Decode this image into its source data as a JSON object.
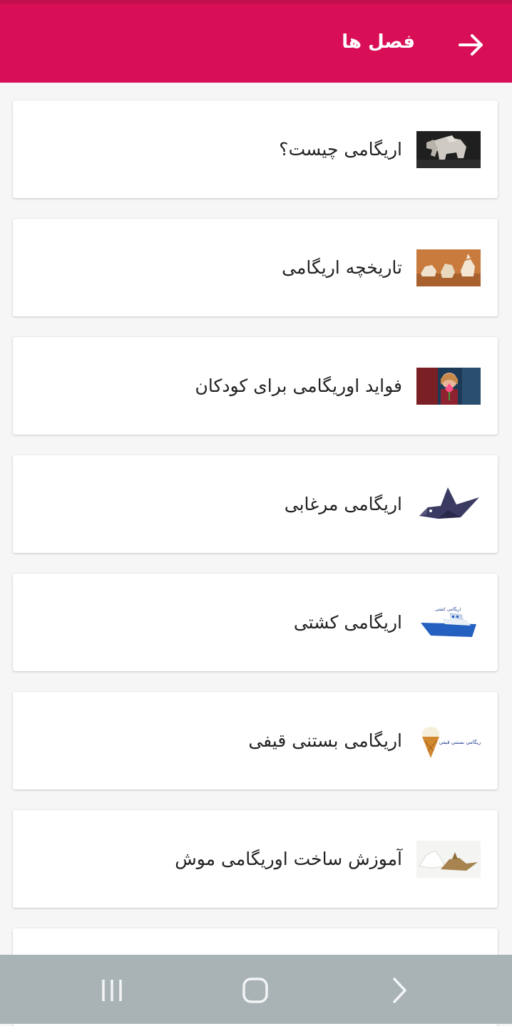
{
  "app_bar": {
    "title": "فصل ها",
    "back_icon": "arrow-right-icon",
    "color": "#d80f57"
  },
  "chapters": [
    {
      "title": "اریگامی چیست؟",
      "thumbnail": "origami-elephant"
    },
    {
      "title": "تاریخچه اریگامی",
      "thumbnail": "origami-animals"
    },
    {
      "title": "فواید اوریگامی برای کودکان",
      "thumbnail": "child-with-origami-flower"
    },
    {
      "title": "اریگامی مرغابی",
      "thumbnail": "origami-duck"
    },
    {
      "title": "اریگامی کشتی",
      "thumbnail": "origami-ship",
      "thumbnail_caption": "اریگامی کشتی"
    },
    {
      "title": "اریگامی بستنی قیفی",
      "thumbnail": "origami-ice-cream",
      "thumbnail_caption": "اریگامی بستنی قیفی"
    },
    {
      "title": "آموزش ساخت اوریگامی موش",
      "thumbnail": "origami-mouse"
    }
  ],
  "system_nav": {
    "recents_icon": "recents-icon",
    "home_icon": "home-icon",
    "back_icon": "chevron-right-icon"
  }
}
